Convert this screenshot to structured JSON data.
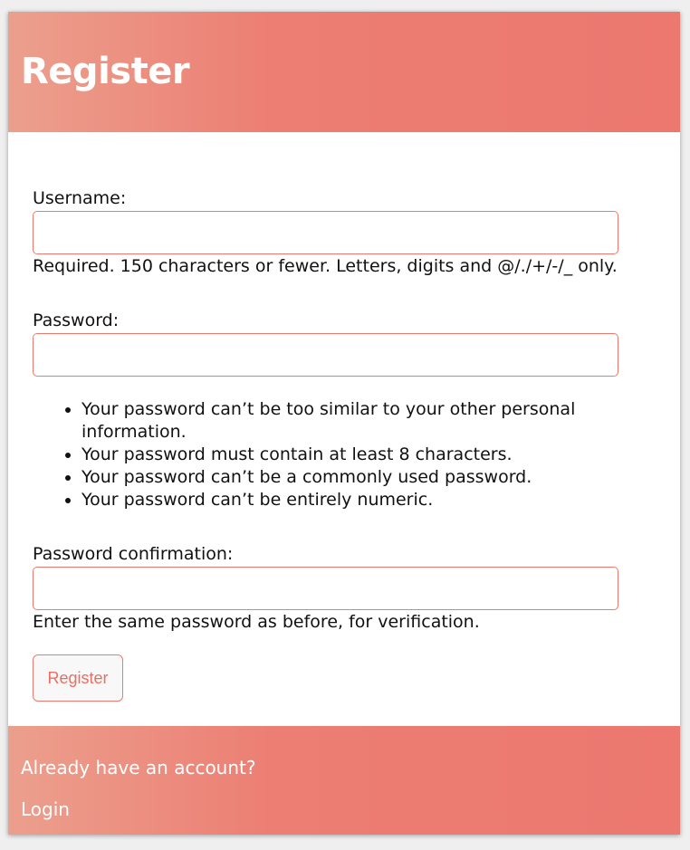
{
  "header": {
    "title": "Register"
  },
  "form": {
    "username": {
      "label": "Username:",
      "value": "",
      "help": "Required. 150 characters or fewer. Letters, digits and @/./+/-/_ only."
    },
    "password": {
      "label": "Password:",
      "value": "",
      "rules": [
        "Your password can’t be too similar to your other personal information.",
        "Your password must contain at least 8 characters.",
        "Your password can’t be a commonly used password.",
        "Your password can’t be entirely numeric."
      ]
    },
    "password_confirmation": {
      "label": "Password confirmation:",
      "value": "",
      "help": "Enter the same password as before, for verification."
    },
    "submit_label": "Register"
  },
  "footer": {
    "question": "Already have an account?",
    "login_link": "Login"
  },
  "colors": {
    "accent": "#ec7870",
    "accent_light": "#ec9f8d",
    "button_text": "#ec6e62"
  }
}
